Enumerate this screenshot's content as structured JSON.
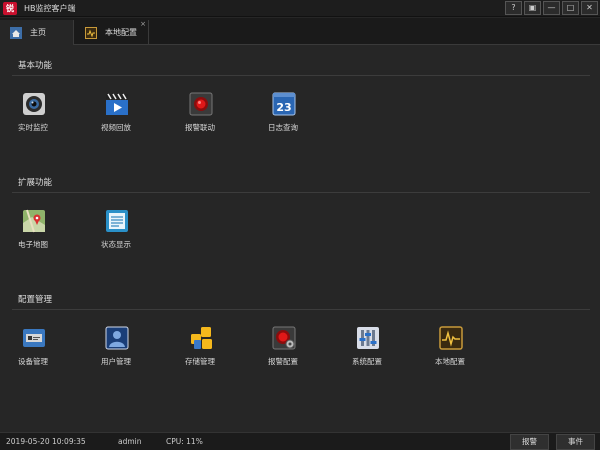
{
  "window": {
    "logo_text": "锐",
    "title": "HB监控客户端",
    "buttons": [
      "?",
      "▣",
      "—",
      "□",
      "✕"
    ]
  },
  "tabs": [
    {
      "label": "主页",
      "icon": "home-icon",
      "active": true
    },
    {
      "label": "本地配置",
      "icon": "local-config-icon",
      "active": false,
      "close": "×"
    }
  ],
  "sections": [
    {
      "title": "基本功能",
      "items": [
        {
          "label": "实时监控",
          "icon": "camera-icon"
        },
        {
          "label": "视频回放",
          "icon": "video-playback-icon"
        },
        {
          "label": "报警联动",
          "icon": "alarm-icon"
        },
        {
          "label": "日志查询",
          "icon": "calendar-log-icon",
          "icon_text": "23"
        }
      ]
    },
    {
      "title": "扩展功能",
      "items": [
        {
          "label": "电子地图",
          "icon": "map-icon"
        },
        {
          "label": "状态显示",
          "icon": "status-icon"
        }
      ]
    },
    {
      "title": "配置管理",
      "items": [
        {
          "label": "设备管理",
          "icon": "device-icon"
        },
        {
          "label": "用户管理",
          "icon": "user-icon"
        },
        {
          "label": "存储管理",
          "icon": "storage-icon"
        },
        {
          "label": "报警配置",
          "icon": "alarm-config-icon"
        },
        {
          "label": "系统配置",
          "icon": "system-config-icon"
        },
        {
          "label": "本地配置",
          "icon": "local-config-icon"
        }
      ]
    }
  ],
  "status": {
    "datetime": "2019-05-20 10:09:35",
    "user": "admin",
    "cpu": "CPU: 11%",
    "alarm_button": "报警",
    "event_button": "事件"
  },
  "colors": {
    "background": "#262626",
    "logo_red": "#c8102e",
    "calendar_blue": "#2a66b3"
  }
}
